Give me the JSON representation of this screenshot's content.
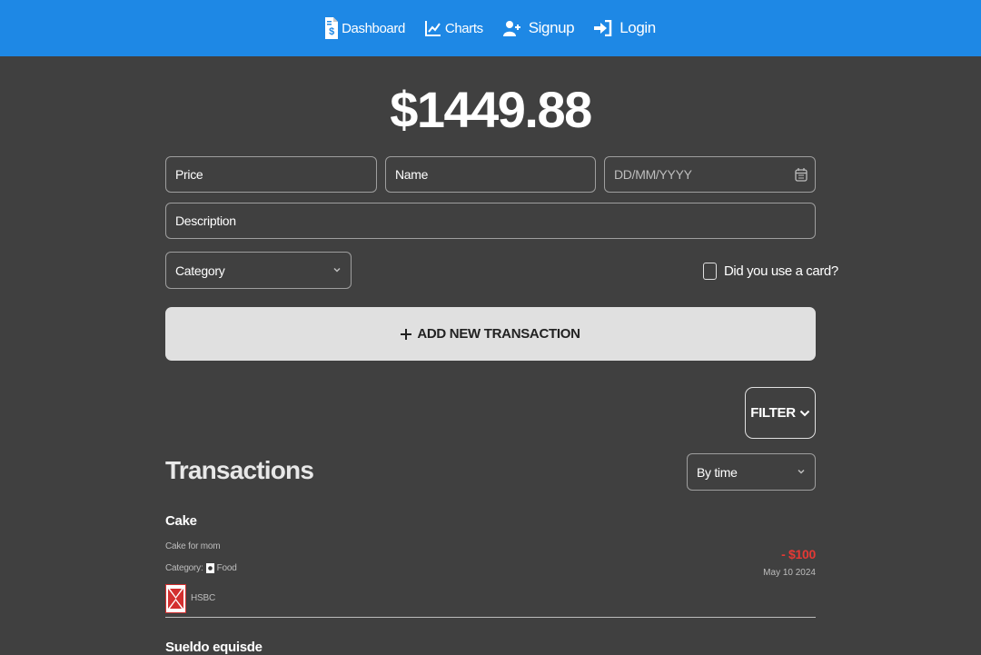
{
  "nav": {
    "dashboard": "Dashboard",
    "charts": "Charts",
    "signup": "Signup",
    "login": "Login"
  },
  "balance": "$1449.88",
  "form": {
    "price_placeholder": "Price",
    "name_placeholder": "Name",
    "date_placeholder": "DD/MM/YYYY",
    "description_placeholder": "Description",
    "category_label": "Category",
    "card_label": "Did you use a card?",
    "add_button_label": "ADD NEW TRANSACTION"
  },
  "filter_label": "FILTER",
  "transactions": {
    "title": "Transactions",
    "sort_value": "By time",
    "items": [
      {
        "name": "Cake",
        "description": "Cake for mom",
        "category_prefix": "Category:",
        "category": "Food",
        "bank": "HSBC",
        "amount": "- $100",
        "date": "May 10 2024"
      },
      {
        "name": "Sueldo equisde"
      }
    ]
  },
  "colors": {
    "navbar": "#1e88e5",
    "background": "#404040",
    "expense": "#e53935",
    "button": "#e0e0e0"
  },
  "icons": {
    "dashboard": "invoice-dollar-icon",
    "charts": "line-chart-icon",
    "signup": "user-plus-icon",
    "login": "sign-in-icon",
    "calendar": "calendar-icon",
    "add": "plus-icon",
    "filter": "chevron-down-icon",
    "category": "food-icon",
    "bank": "hsbc-logo"
  }
}
